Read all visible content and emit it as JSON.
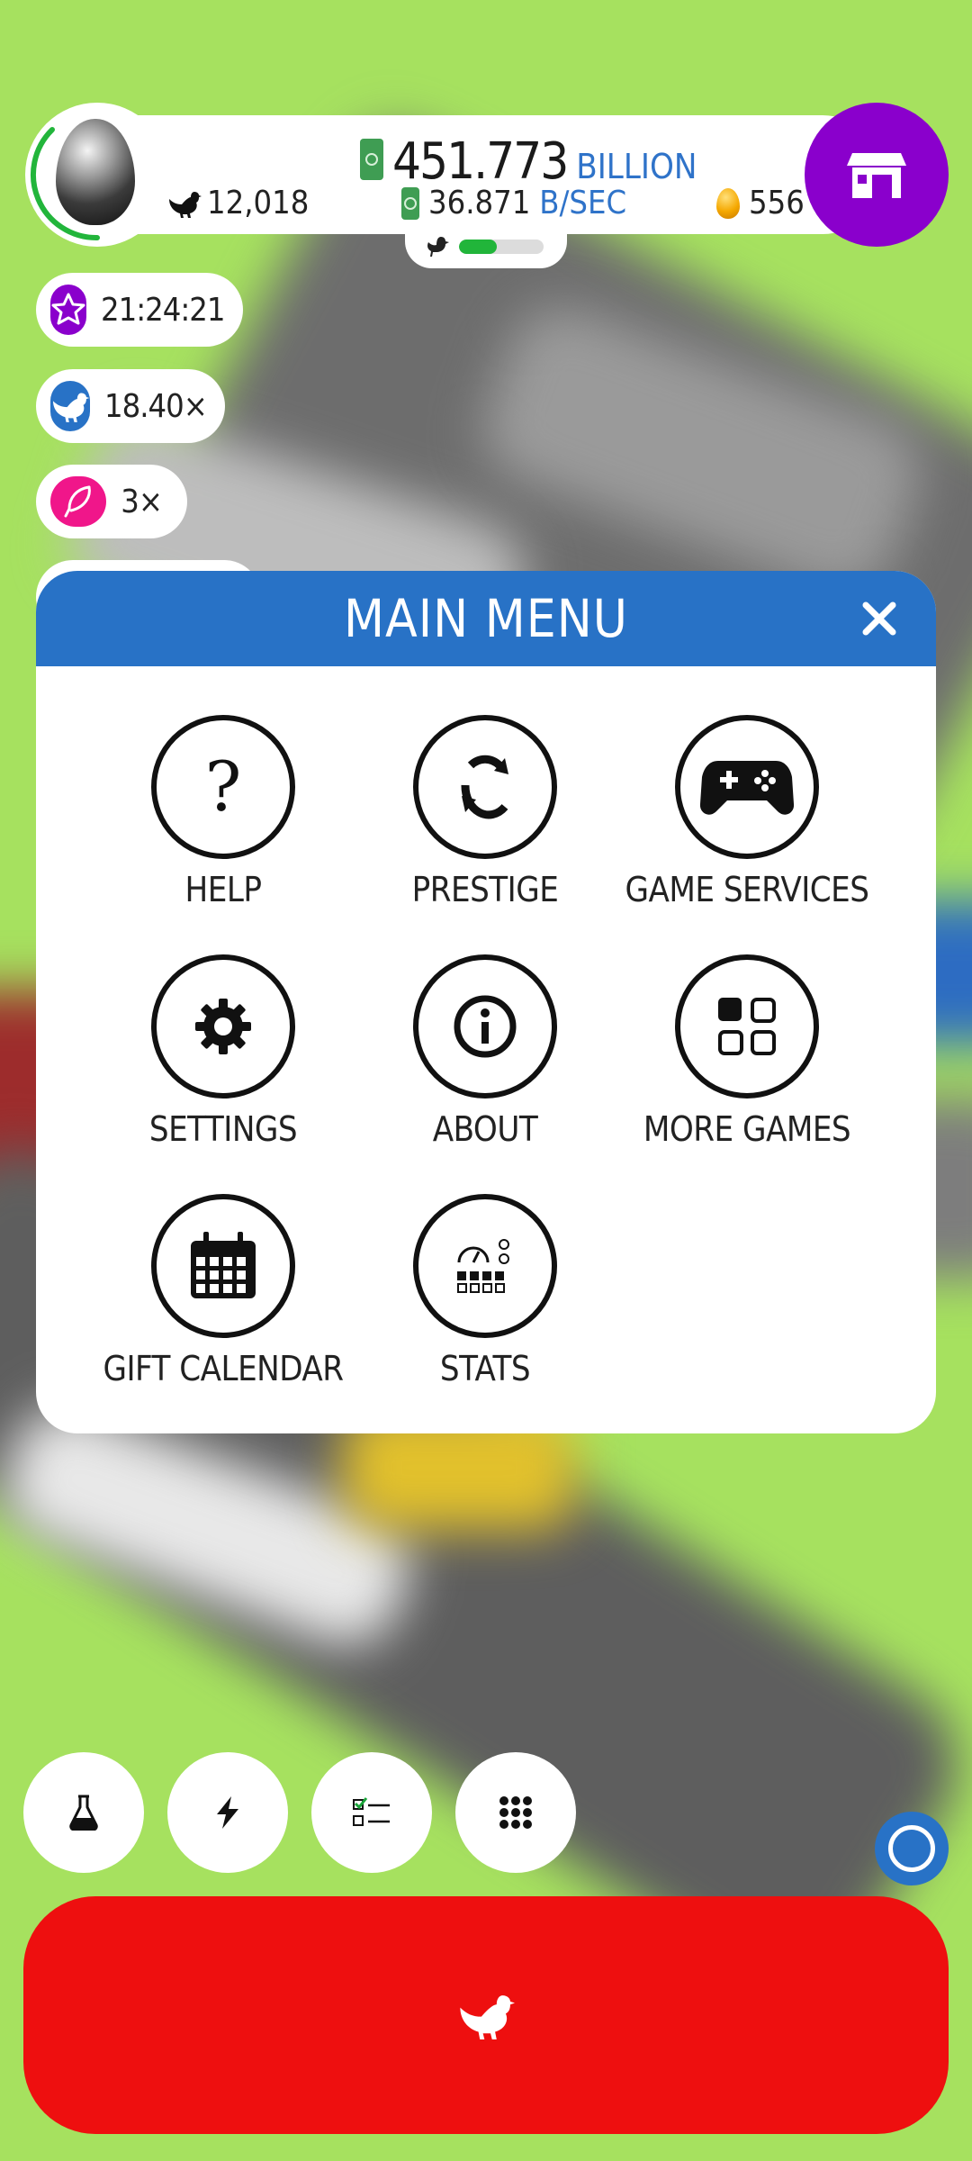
{
  "hud": {
    "money_value": "451.773",
    "money_unit": "BILLION",
    "chicken_count": "12,018",
    "earn_rate_value": "36.871",
    "earn_rate_unit": "B/SEC",
    "golden_eggs": "556",
    "habitat_progress": 0.45
  },
  "boosts": [
    {
      "icon": "star-icon",
      "label": "21:24:21",
      "color": "#8a00cc"
    },
    {
      "icon": "chicken-icon",
      "label": "18.40×",
      "color": "#2872c6"
    },
    {
      "icon": "feather-icon",
      "label": "3×",
      "color": "#f0168a"
    }
  ],
  "menu": {
    "title": "MAIN MENU",
    "items": [
      {
        "label": "HELP",
        "icon": "question-icon"
      },
      {
        "label": "PRESTIGE",
        "icon": "prestige-egg-icon"
      },
      {
        "label": "GAME SERVICES",
        "icon": "gamepad-icon"
      },
      {
        "label": "SETTINGS",
        "icon": "gear-icon"
      },
      {
        "label": "ABOUT",
        "icon": "info-icon"
      },
      {
        "label": "MORE GAMES",
        "icon": "grid-icon"
      },
      {
        "label": "GIFT CALENDAR",
        "icon": "calendar-icon"
      },
      {
        "label": "STATS",
        "icon": "stats-icon"
      }
    ]
  },
  "bottom_buttons": [
    {
      "icon": "flask-icon"
    },
    {
      "icon": "lightning-icon"
    },
    {
      "icon": "checklist-icon"
    },
    {
      "icon": "dots-grid-icon"
    }
  ],
  "colors": {
    "background": "#a6e15f",
    "accent_blue": "#2872c6",
    "shop_purple": "#8a00cc",
    "hatch_red": "#ee0f0f"
  }
}
